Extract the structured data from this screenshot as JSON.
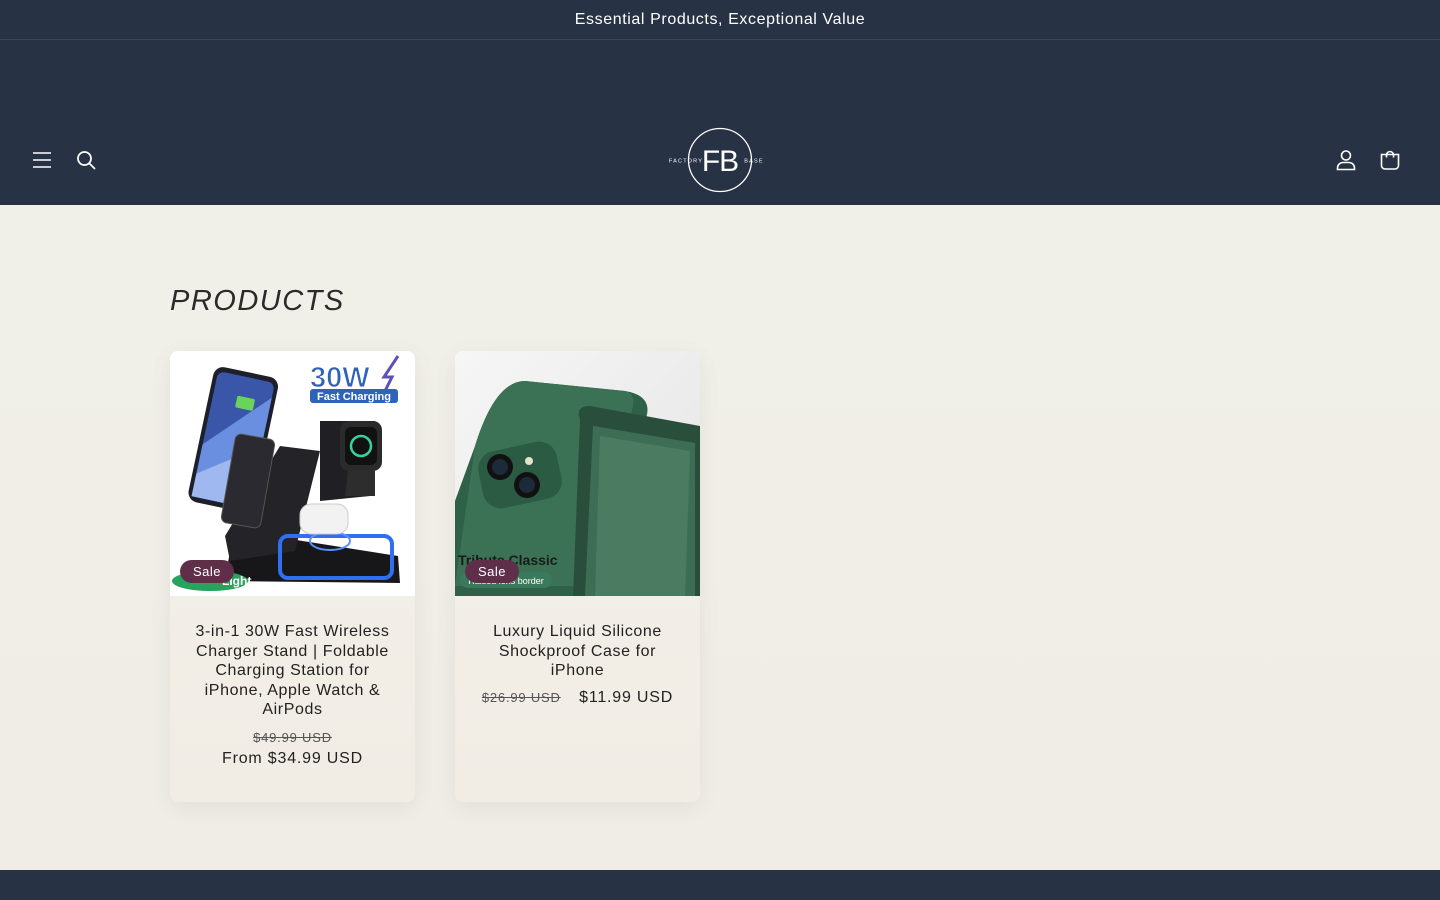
{
  "announcement": {
    "text": "Essential Products, Exceptional Value"
  },
  "header": {
    "logo": {
      "monogram": "FB",
      "left_word": "FACTORY",
      "right_word": "BASE"
    },
    "icons": {
      "menu": "menu-icon",
      "search": "search-icon",
      "account": "account-icon",
      "cart": "cart-icon"
    }
  },
  "main": {
    "title": "PRODUCTS",
    "products": [
      {
        "title": "3-in-1 30W Fast Wireless Charger Stand | Foldable Charging Station for iPhone, Apple Watch & AirPods",
        "badge": "Sale",
        "price_old": "$49.99 USD",
        "price_new": "From $34.99 USD",
        "image_text": {
          "power": "30W",
          "feature": "Fast Charging",
          "light": "Light"
        }
      },
      {
        "title": "Luxury Liquid Silicone Shockproof Case for iPhone",
        "badge": "Sale",
        "price_old": "$26.99 USD",
        "price_new": "$11.99 USD",
        "image_text": {
          "brand": "Tribute Classic",
          "feature": "Raised lens border"
        }
      }
    ]
  },
  "colors": {
    "header_bg": "#273245",
    "badge_bg": "#5f2f4a",
    "page_bg": "#f0efe8"
  }
}
